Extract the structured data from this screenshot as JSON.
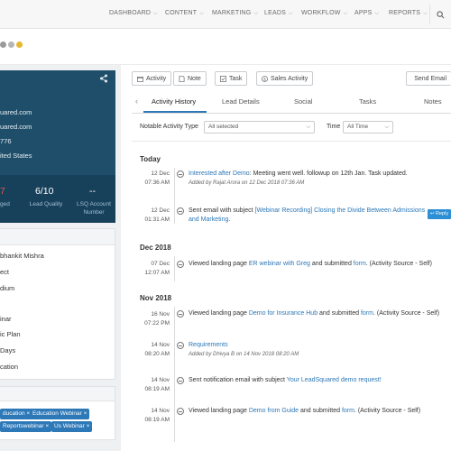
{
  "nav": {
    "items": [
      "DASHBOARD",
      "CONTENT",
      "MARKETING",
      "LEADS",
      "WORKFLOW",
      "APPS",
      "REPORTS"
    ]
  },
  "profile": {
    "email1": "uared.com",
    "email2": "uared.com",
    "phone": "776",
    "country": "ited States",
    "stat1_val": "7",
    "stat1_lbl": "ged",
    "stat2_val": "6/10",
    "stat2_lbl": "Lead Quality",
    "stat3_val": "--",
    "stat3_lbl": "LSQ Account Number"
  },
  "info": {
    "lines": [
      "bhankit Mishra",
      "ect",
      "dium",
      "inar",
      "ic Plan",
      "Days",
      "cation"
    ]
  },
  "tags": [
    "ducation ×",
    "Education Webinar ×",
    "Reportswebinar ×",
    "Us Webinar ×"
  ],
  "toolbar": {
    "activity": "Activity",
    "note": "Note",
    "task": "Task",
    "sales_activity": "Sales Activity",
    "send_email": "Send Email"
  },
  "tabs": {
    "prev": "‹",
    "items": [
      "Activity History",
      "Lead Details",
      "Social",
      "Tasks",
      "Notes"
    ]
  },
  "filters": {
    "type_label": "Notable Activity Type",
    "type_value": "All selected",
    "time_label": "Time",
    "time_value": "All Time"
  },
  "timeline": {
    "groups": [
      "Today",
      "Dec 2018",
      "Nov 2018"
    ],
    "entries": [
      {
        "date": "12 Dec",
        "time": "07:36 AM",
        "prefix": "",
        "link": "Interested after Demo",
        "text": ": Meeting went well. followup on 12th Jan. Task updated.",
        "sub": "Added by Rajat Arora on 12 Dec 2018 07:36 AM"
      },
      {
        "date": "12 Dec",
        "time": "01:31 AM",
        "prefix": "Sent email with subject ",
        "link": "[Webinar Recording] Closing the Divide Between Admissions",
        "link2": "and Marketing",
        "text": "."
      },
      {
        "date": "07 Dec",
        "time": "12:07 AM",
        "prefix": "Viewed landing page ",
        "link": "ER webinar with Greg",
        "mid": " and submitted ",
        "link2": "form",
        "text": ". (Activity Source - Self)"
      },
      {
        "date": "16 Nov",
        "time": "07:22 PM",
        "prefix": "Viewed landing page ",
        "link": "Demo for Insurance Hub",
        "mid": " and submitted ",
        "link2": "form",
        "text": ". (Activity Source - Self)"
      },
      {
        "date": "14 Nov",
        "time": "08:20 AM",
        "prefix": "",
        "link": "Requirements",
        "text": "",
        "sub": "Added by Dhivya B on 14 Nov 2018 08:20 AM"
      },
      {
        "date": "14 Nov",
        "time": "08:19 AM",
        "prefix": "Sent notification email with subject ",
        "link": "Your LeadSquared demo request!",
        "text": ""
      },
      {
        "date": "14 Nov",
        "time": "08:19 AM",
        "prefix": "Viewed landing page ",
        "link": "Demo from Guide",
        "mid": " and submitted ",
        "link2": "form",
        "text": ". (Activity Source - Self)"
      }
    ],
    "reply": "↩ Reply"
  }
}
